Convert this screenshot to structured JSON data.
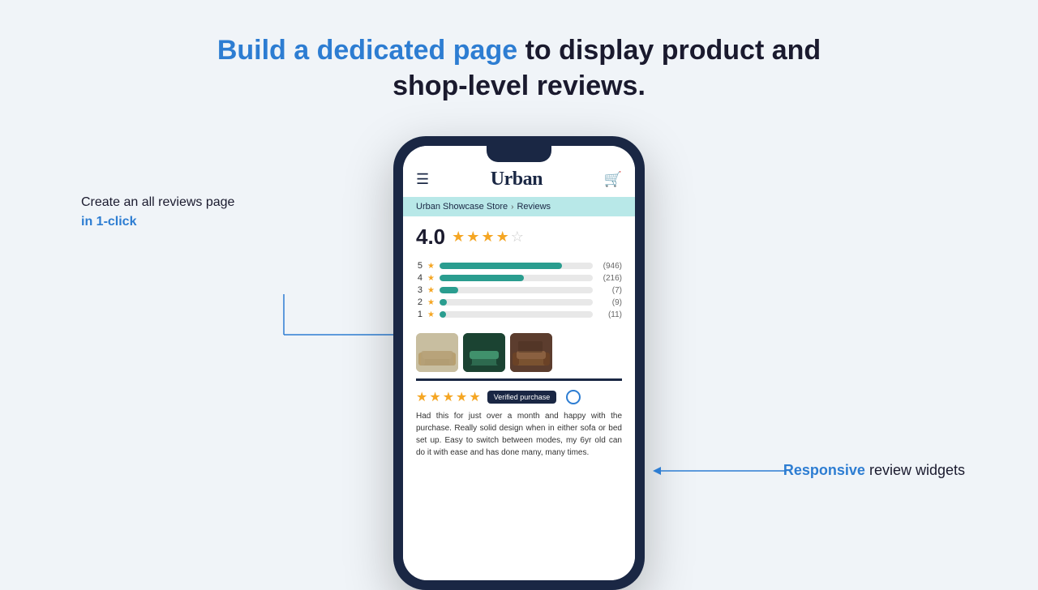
{
  "page": {
    "background_color": "#f0f4f8"
  },
  "headline": {
    "part1": "Build a dedicated page",
    "part2": " to display product and",
    "part3": "shop-level reviews."
  },
  "left_annotation": {
    "line1": "Create an all reviews page",
    "line2": "in 1-click"
  },
  "right_annotation": {
    "part1": "Responsive",
    "part2": " review widgets"
  },
  "phone": {
    "store_name": "Urban",
    "breadcrumb": {
      "store": "Urban Showcase Store",
      "separator": "›",
      "page": "Reviews"
    },
    "overall_rating": {
      "score": "4.0",
      "stars_filled": 4,
      "stars_empty": 1
    },
    "rating_bars": [
      {
        "label": "5",
        "count": "(946)",
        "width_pct": 80
      },
      {
        "label": "4",
        "count": "(216)",
        "width_pct": 55
      },
      {
        "label": "3",
        "count": "(7)",
        "width_pct": 12
      },
      {
        "label": "2",
        "count": "(9)",
        "width_pct": 5
      },
      {
        "label": "1",
        "count": "(11)",
        "width_pct": 4
      }
    ],
    "review": {
      "stars": 5,
      "verified_label": "Verified purchase",
      "text": "Had this for just over a month and happy with the purchase. Really solid design when in either sofa or bed set up. Easy to switch between modes, my 6yr old can do it with ease and has done many, many times."
    },
    "header": {
      "menu_icon": "☰",
      "cart_icon": "🛒"
    }
  }
}
